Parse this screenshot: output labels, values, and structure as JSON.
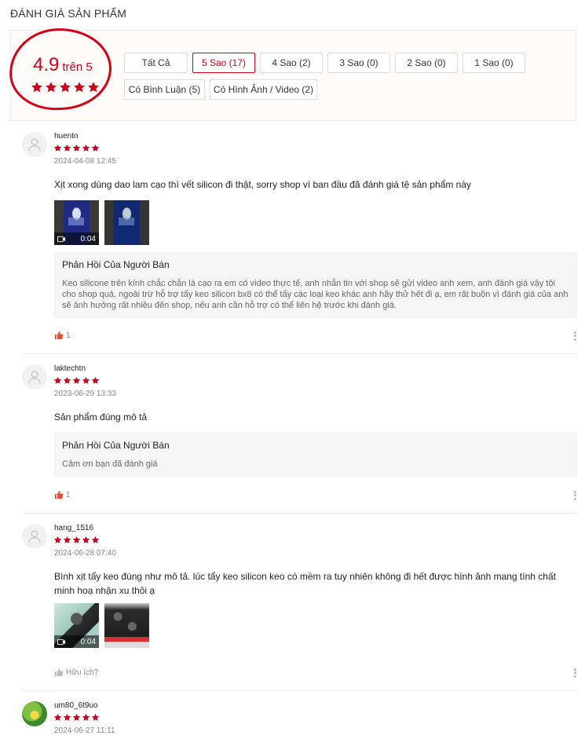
{
  "section_title": "ĐÁNH GIÁ SẢN PHẨM",
  "overview": {
    "score": "4.9",
    "score_suffix": "trên 5",
    "stars": 5,
    "accent": "#d0011b",
    "filters": [
      {
        "label": "Tất Cả",
        "active": false
      },
      {
        "label": "5 Sao (17)",
        "active": true
      },
      {
        "label": "4 Sao (2)",
        "active": false
      },
      {
        "label": "3 Sao (0)",
        "active": false
      },
      {
        "label": "2 Sao (0)",
        "active": false
      },
      {
        "label": "1 Sao (0)",
        "active": false
      },
      {
        "label": "Có Bình Luận (5)",
        "active": false
      },
      {
        "label": "Có Hình Ảnh / Video (2)",
        "active": false
      }
    ]
  },
  "reviews": [
    {
      "username": "huentn",
      "stars": 5,
      "date": "2024-04-08 12:45",
      "text": "Xịt xong dùng dao lam cạo thì vết silicon đi thật, sorry shop vì ban đầu đã đánh giá tệ sản phẩm này",
      "video_duration": "0:04",
      "reply_title": "Phản Hồi Của Người Bán",
      "reply_text": "Keo silicone trên kính chắc chắn là cạo ra em có video thực tế, anh nhắn tin với shop sẽ gửi video anh xem, anh đánh giá vậy tội cho shop quá, ngoài trừ hỗ trợ tẩy keo silicon bx8 có thể tẩy các loại keo khác anh hãy thử hết đi ạ, em rất buồn vì đánh giá của anh sẽ ảnh hưởng rất nhiều đến shop, nếu anh cần hỗ trợ có thể liên hệ trước khi đánh giá.",
      "likes": "1"
    },
    {
      "username": "laktechtn",
      "stars": 5,
      "date": "2023-06-29 13:33",
      "text": "Sản phẩm đúng mô tả",
      "reply_title": "Phản Hồi Của Người Bán",
      "reply_text": "Cảm ơn bạn đã đánh giá",
      "likes": "1"
    },
    {
      "username": "hang_1516",
      "stars": 5,
      "date": "2024-06-28 07:40",
      "text": "Bình xịt tẩy keo đúng như mô tả. lúc tẩy keo silicon keo có mềm ra tuy nhiên không đi hết được hình ảnh mang tính chất minh hoạ nhận xu thôi ạ",
      "video_duration": "0:04",
      "helpful_label": "Hữu ích?"
    },
    {
      "username": "um80_6t9uo",
      "stars": 5,
      "date": "2024-06-27 11:11"
    }
  ]
}
